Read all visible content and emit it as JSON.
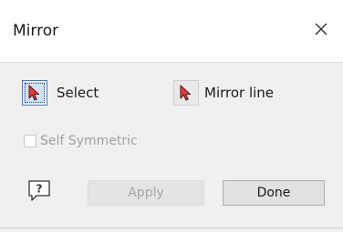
{
  "window": {
    "title": "Mirror",
    "close_icon": "close-icon"
  },
  "tools": {
    "select": {
      "label": "Select",
      "icon": "cursor-select-icon",
      "active": true
    },
    "mirror_line": {
      "label": "Mirror line",
      "icon": "cursor-select-icon",
      "active": false
    }
  },
  "options": {
    "self_symmetric": {
      "label": "Self Symmetric",
      "checked": false,
      "enabled": false
    }
  },
  "footer": {
    "help_icon": "help-icon",
    "apply_label": "Apply",
    "apply_enabled": false,
    "done_label": "Done"
  },
  "colors": {
    "cursor_red": "#e03c3c",
    "active_blue": "#3a78c8",
    "disabled_text": "#a6a6a6"
  }
}
